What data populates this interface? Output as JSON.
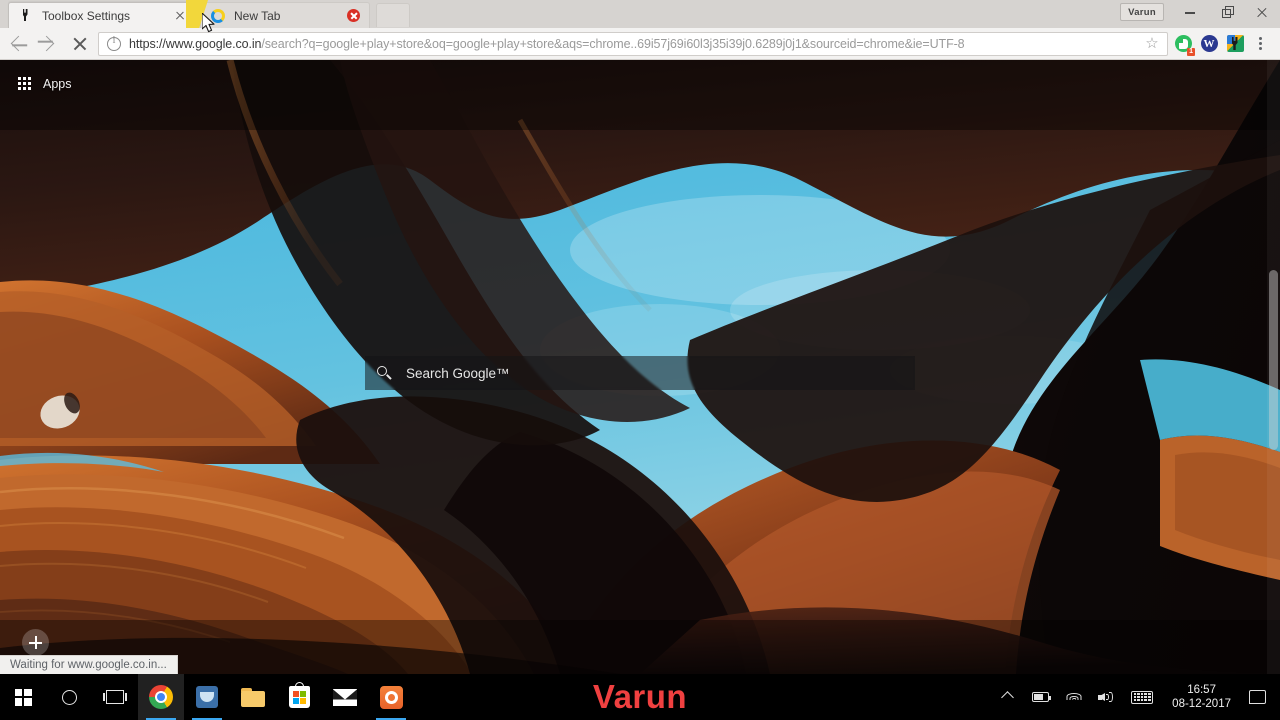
{
  "window": {
    "profile_name": "Varun",
    "controls": {
      "minimize": "minimize",
      "restore": "restore",
      "close": "close"
    }
  },
  "tabs": [
    {
      "title": "Toolbox Settings",
      "favicon": "toolbox-icon",
      "active": true,
      "close_label": "close-tab"
    },
    {
      "title": "New Tab",
      "favicon": "loading-spinner-icon",
      "active": false,
      "close_label": "close-tab"
    }
  ],
  "newtab_button": {
    "label": "new-tab-button"
  },
  "toolbar": {
    "back": "back-button",
    "forward": "forward-button",
    "stop": "stop-loading-button",
    "security_icon": "info-icon",
    "url_domain": "https://www.google.co.in",
    "url_path": "/search?q=google+play+store&oq=google+play+store&aqs=chrome..69i57j69i60l3j35i39j0.6289j0j1&sourceid=chrome&ie=UTF-8",
    "url_full": "https://www.google.co.in/search?q=google+play+store&oq=google+play+store&aqs=chrome..69i57j69i60l3j35i39j0.6289j0j1&sourceid=chrome&ie=UTF-8",
    "bookmark_star": "☆",
    "extensions": [
      {
        "name": "evernote-extension-icon",
        "badge": "1"
      },
      {
        "name": "wikibuy-extension-icon",
        "letter": "W"
      },
      {
        "name": "toolbox-extension-icon"
      }
    ],
    "menu": "chrome-menu-button"
  },
  "bookmarks_bar": {
    "apps_label": "Apps",
    "apps_icon": "apps-grid-icon"
  },
  "newtab_page": {
    "search_placeholder": "Search Google™",
    "search_icon": "search-icon",
    "add_shortcut": "+",
    "scrollbar": "page-scrollbar"
  },
  "status_bar": {
    "text": "Waiting for www.google.co.in..."
  },
  "taskbar": {
    "items": [
      {
        "name": "start-button",
        "icon": "windows-logo-icon",
        "running": false
      },
      {
        "name": "cortana-button",
        "icon": "circle-icon",
        "running": false
      },
      {
        "name": "task-view-button",
        "icon": "task-view-icon",
        "running": false
      },
      {
        "name": "taskbar-chrome",
        "icon": "chrome-icon",
        "running": true,
        "active": true
      },
      {
        "name": "taskbar-blue-app",
        "icon": "blue-app-icon",
        "running": true
      },
      {
        "name": "taskbar-file-explorer",
        "icon": "folder-icon",
        "running": false
      },
      {
        "name": "taskbar-microsoft-store",
        "icon": "store-bag-icon",
        "running": false
      },
      {
        "name": "taskbar-mail",
        "icon": "envelope-icon",
        "running": false
      },
      {
        "name": "taskbar-orange-app",
        "icon": "orange-app-icon",
        "running": true
      }
    ],
    "watermark": "Varun",
    "tray": {
      "show_hidden": "chevron-up-icon",
      "battery": "battery-icon",
      "network": "wifi-icon",
      "volume": "volume-icon",
      "keyboard": "keyboard-icon",
      "time": "16:57",
      "date": "08-12-2017",
      "action_center": "action-center-icon"
    }
  },
  "colors": {
    "sky": "#5cbcdd",
    "rock_light": "#c5642c",
    "rock_mid": "#8a3f20",
    "rock_dark": "#2a1310",
    "rock_black": "#120a0a",
    "accent_red": "#f04040",
    "chrome_bg": "#f3f2f1",
    "tabstrip_bg": "#d6d3d0"
  }
}
